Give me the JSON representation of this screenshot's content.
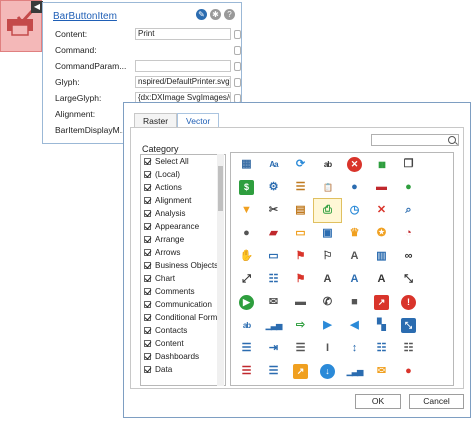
{
  "panel": {
    "title": "BarButtonItem",
    "rows": [
      {
        "label": "Content:",
        "value": "Print"
      },
      {
        "label": "Command:",
        "value": ""
      },
      {
        "label": "CommandParam...",
        "value": ""
      },
      {
        "label": "Glyph:",
        "value": "nspired/DefaultPrinter.svg}"
      },
      {
        "label": "LargeGlyph:",
        "value": "{dx:DXImage SvgImages/O..."
      },
      {
        "label": "Alignment:",
        "value": ""
      },
      {
        "label": "BarItemDisplayM...",
        "value": ""
      }
    ]
  },
  "dialog": {
    "tabs": [
      "Raster",
      "Vector"
    ],
    "active_tab": "Vector",
    "category_label": "Category",
    "categories": [
      "Select All",
      "(Local)",
      "Actions",
      "Alignment",
      "Analysis",
      "Appearance",
      "Arrange",
      "Arrows",
      "Business Objects",
      "Chart",
      "Comments",
      "Communication",
      "Conditional Forma",
      "Contacts",
      "Content",
      "Dashboards",
      "Data"
    ],
    "ok_label": "OK",
    "cancel_label": "Cancel"
  },
  "icons": [
    [
      "grid-small-icon",
      "text-aa-icon",
      "refresh-icon",
      "spell-check-icon",
      "delete-circle-icon",
      "battery-icon",
      "copy-icon",
      "blank"
    ],
    [
      "currency-icon",
      "gear-icon",
      "document-list-icon",
      "clipboard-icon",
      "map-pin-icon",
      "truck-icon",
      "user-icon",
      "blank"
    ],
    [
      "filter-icon",
      "scissors-icon",
      "page-setup-icon",
      "printer-icon",
      "history-icon",
      "close-x-icon",
      "zoom-doc-icon",
      "blank"
    ],
    [
      "user-pilot-icon",
      "car-icon",
      "folder-icon",
      "contact-card-icon",
      "trophy-icon",
      "award-icon",
      "stopwatch-icon",
      "blank"
    ],
    [
      "handshake-icon",
      "window-icon",
      "flag-red-icon",
      "flag-outline-icon",
      "font-a-icon",
      "building-icon",
      "binoculars-icon",
      "blank"
    ],
    [
      "expand-arrows-icon",
      "list-window-icon",
      "flag-icon",
      "text-a-icon",
      "font-color-icon",
      "font-size-icon",
      "fit-icon",
      "blank"
    ],
    [
      "play-icon",
      "mail-icon",
      "comment-icon",
      "phone-icon",
      "video-icon",
      "trend-up-icon",
      "warning-circle-icon",
      "blank"
    ],
    [
      "spell-check-alt-icon",
      "bar-chart-icon",
      "export-icon",
      "triangle-right-icon",
      "triangle-left-icon",
      "tiles-icon",
      "resize-icon",
      "blank"
    ],
    [
      "align-icon",
      "indent-icon",
      "list-text-icon",
      "italic-icon",
      "line-spacing-icon",
      "bullets-icon",
      "numbered-list-icon",
      "blank"
    ],
    [
      "list-icon",
      "numbered-icon",
      "chart-up-icon",
      "download-circle-icon",
      "signal-icon",
      "mail-open-icon",
      "location-icon",
      "blank"
    ]
  ],
  "selected_icon": "printer-icon"
}
